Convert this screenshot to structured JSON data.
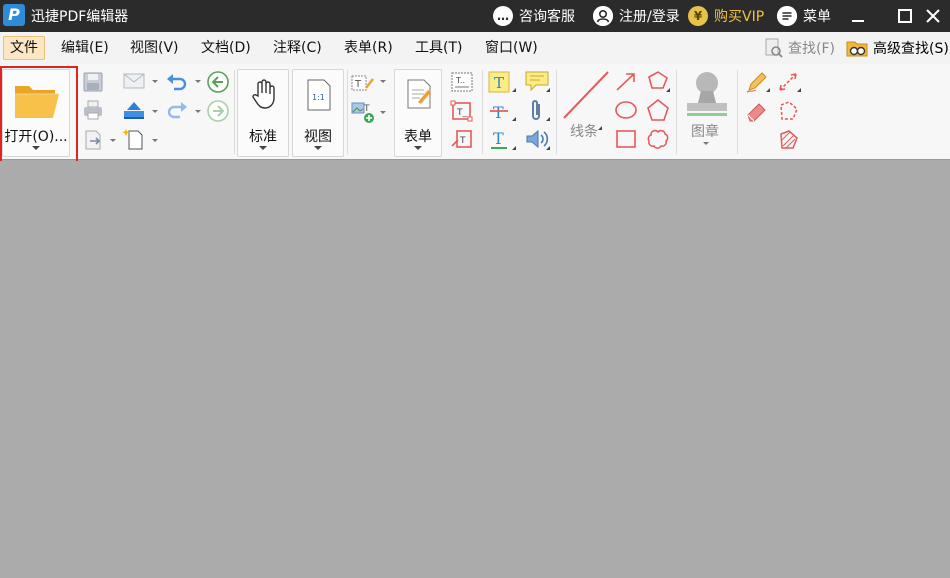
{
  "app": {
    "logo_letter": "P",
    "title": "迅捷PDF编辑器"
  },
  "titlebar": {
    "consult_label": "咨询客服",
    "login_label": "注册/登录",
    "vip_symbol": "¥",
    "vip_label": "购买VIP",
    "menu_label": "菜单"
  },
  "menubar": {
    "items": [
      "文件",
      "编辑(E)",
      "视图(V)",
      "文档(D)",
      "注释(C)",
      "表单(R)",
      "工具(T)",
      "窗口(W)"
    ],
    "find_label": "查找(F)",
    "advanced_find_label": "高级查找(S)"
  },
  "ribbon": {
    "open_label": "打开(O)...",
    "standard_label": "标准",
    "view_label": "视图",
    "view_icon_text": "1:1",
    "form_label": "表单",
    "line_label": "线条",
    "stamp_label": "图章"
  },
  "colors": {
    "titlebar_bg": "#2b2b2b",
    "vip_gold": "#f0c040",
    "workspace_bg": "#ababab",
    "annotation_red": "#e55a5a",
    "highlight_box": "#e02424"
  }
}
